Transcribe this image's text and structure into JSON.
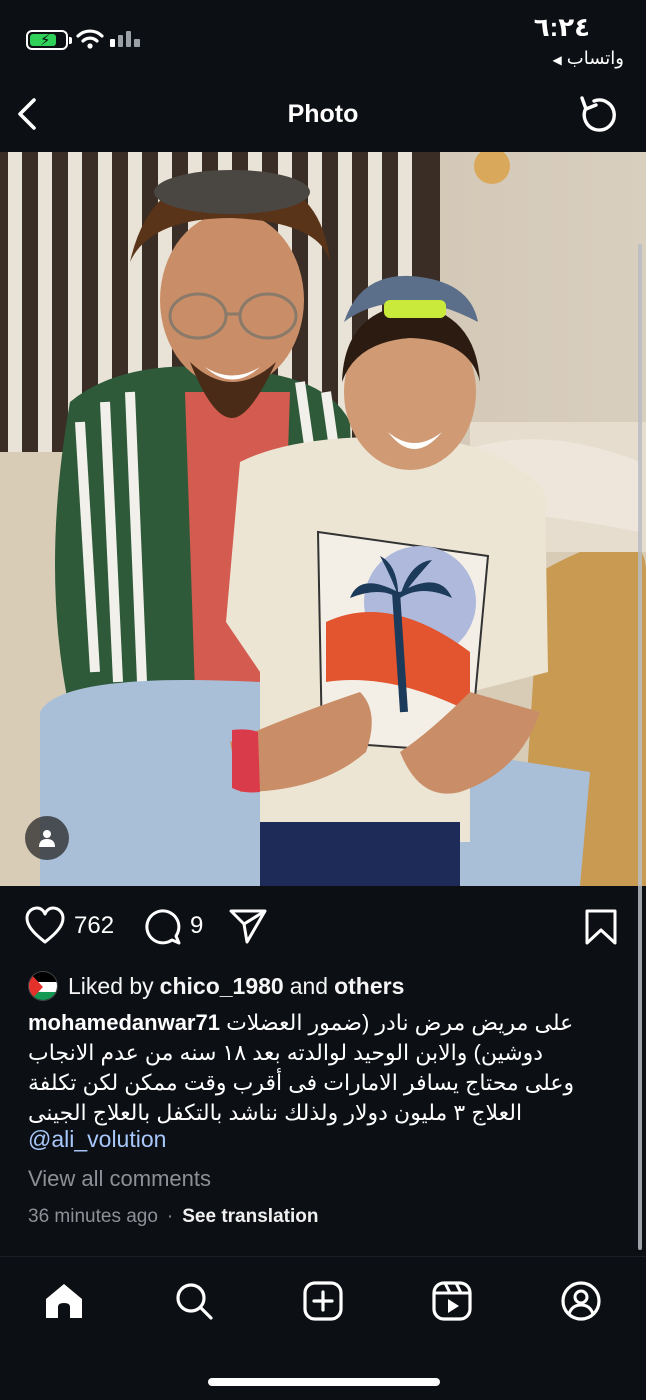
{
  "status_bar": {
    "time": "٦:٢٤",
    "back_app": "واتساب",
    "battery_icon": "battery-charging-icon",
    "wifi_icon": "wifi-icon",
    "signal_icon": "signal-icon"
  },
  "header": {
    "title": "Photo",
    "back_icon": "chevron-left-icon",
    "refresh_icon": "refresh-icon"
  },
  "post": {
    "photo_icon": "tagged-user-icon",
    "likes_count": "762",
    "comments_count": "9",
    "liked_by": {
      "prefix": "Liked by",
      "user": "chico_1980",
      "and": "and",
      "others": "others"
    },
    "caption": {
      "username": "mohamedanwar71",
      "line1": "على مريض مرض نادر (ضمور العضلات",
      "line2": "دوشين) والابن الوحيد لوالدته بعد ١٨ سنه من عدم الانجاب",
      "line3": "وعلى محتاج يسافر  الامارات فى أقرب وقت ممكن لكن تكلفة",
      "line4": "العلاج ٣ مليون دولار ولذلك نناشد بالتكفل بالعلاج الجينى",
      "mention": "@ali_volution"
    },
    "view_comments": "View all comments",
    "timestamp": "36 minutes ago",
    "separator": "·",
    "see_translation": "See translation"
  },
  "bottom_nav": {
    "items": [
      "home-icon",
      "search-icon",
      "create-icon",
      "reels-icon",
      "profile-icon"
    ]
  },
  "colors": {
    "background": "#0c0f14",
    "mention": "#a8c7fa",
    "muted": "#8e9096",
    "battery": "#30d158"
  }
}
